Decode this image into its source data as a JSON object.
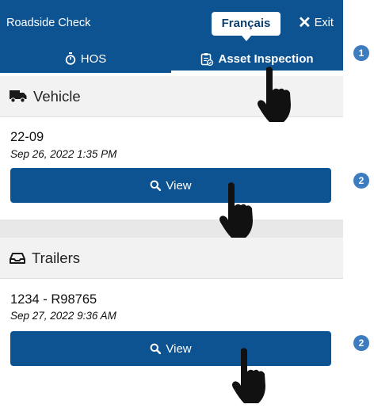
{
  "topbar": {
    "title": "Roadside Check",
    "language_button": "Français",
    "exit_label": "Exit"
  },
  "tabs": [
    {
      "label": "HOS",
      "icon": "stopwatch-icon",
      "active": false
    },
    {
      "label": "Asset Inspection",
      "icon": "clipboard-check-icon",
      "active": true
    }
  ],
  "vehicle": {
    "header": "Vehicle",
    "icon": "truck-icon",
    "id": "22-09",
    "date": "Sep 26, 2022 1:35 PM",
    "view_label": "View"
  },
  "trailers": {
    "header": "Trailers",
    "icon": "inbox-icon",
    "id": "1234 - R98765",
    "date": "Sep 27, 2022 9:36 AM",
    "view_label": "View"
  },
  "annotations": {
    "badge_1": "1",
    "badge_2a": "2",
    "badge_2b": "2"
  },
  "colors": {
    "primary": "#0d5391",
    "badge": "#3d7cbf",
    "section_bg": "#f2f2f2"
  }
}
